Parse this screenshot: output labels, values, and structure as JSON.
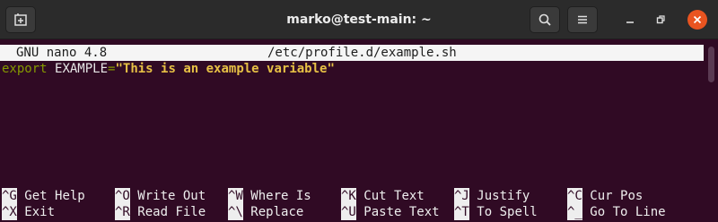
{
  "window": {
    "title": "marko@test-main: ~",
    "accent_close": "#e95420"
  },
  "titlebar_icons": {
    "new_tab": "new-tab-icon",
    "search": "search-icon",
    "menu": "hamburger-menu-icon",
    "minimize": "minimize-icon",
    "maximize": "maximize-icon",
    "close": "close-icon"
  },
  "nano": {
    "version": "GNU nano 4.8",
    "filename": "/etc/profile.d/example.sh"
  },
  "editor": {
    "keyword": "export",
    "name": "EXAMPLE",
    "equals": "=",
    "value": "\"This is an example variable\""
  },
  "shortcuts": [
    [
      {
        "key": "^G",
        "label": "Get Help"
      },
      {
        "key": "^X",
        "label": "Exit"
      }
    ],
    [
      {
        "key": "^O",
        "label": "Write Out"
      },
      {
        "key": "^R",
        "label": "Read File"
      }
    ],
    [
      {
        "key": "^W",
        "label": "Where Is"
      },
      {
        "key": "^\\",
        "label": "Replace"
      }
    ],
    [
      {
        "key": "^K",
        "label": "Cut Text"
      },
      {
        "key": "^U",
        "label": "Paste Text"
      }
    ],
    [
      {
        "key": "^J",
        "label": "Justify"
      },
      {
        "key": "^T",
        "label": "To Spell"
      }
    ],
    [
      {
        "key": "^C",
        "label": "Cur Pos"
      },
      {
        "key": "^_",
        "label": "Go To Line"
      }
    ]
  ]
}
